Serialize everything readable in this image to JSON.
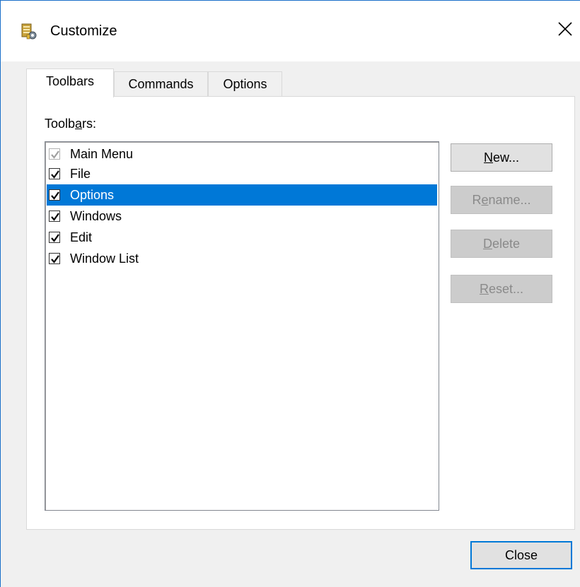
{
  "window": {
    "title": "Customize",
    "icon": "customize-app-icon"
  },
  "tabs": [
    {
      "label": "Toolbars",
      "active": true
    },
    {
      "label": "Commands",
      "active": false
    },
    {
      "label": "Options",
      "active": false
    }
  ],
  "toolbars_group": {
    "label_before": "Toolb",
    "label_mnemonic": "a",
    "label_after": "rs:"
  },
  "toolbar_list": [
    {
      "label": "Main Menu",
      "checked": true,
      "disabled": true
    },
    {
      "label": "File",
      "checked": true,
      "disabled": false
    },
    {
      "label": "Options",
      "checked": true,
      "disabled": false,
      "selected": true
    },
    {
      "label": "Windows",
      "checked": true,
      "disabled": false
    },
    {
      "label": "Edit",
      "checked": true,
      "disabled": false
    },
    {
      "label": "Window List",
      "checked": true,
      "disabled": false
    }
  ],
  "buttons": {
    "new": {
      "mnemonic": "N",
      "rest": "ew...",
      "enabled": true
    },
    "rename": {
      "before": "R",
      "mnemonic": "e",
      "rest": "name...",
      "enabled": false
    },
    "delete": {
      "mnemonic": "D",
      "rest": "elete",
      "enabled": false
    },
    "reset": {
      "mnemonic": "R",
      "rest": "eset...",
      "enabled": false
    },
    "close": {
      "label": "Close",
      "enabled": true
    }
  },
  "colors": {
    "selection": "#0078d7",
    "window_border": "#1a6fc9",
    "disabled_text": "#8a8a8a"
  }
}
